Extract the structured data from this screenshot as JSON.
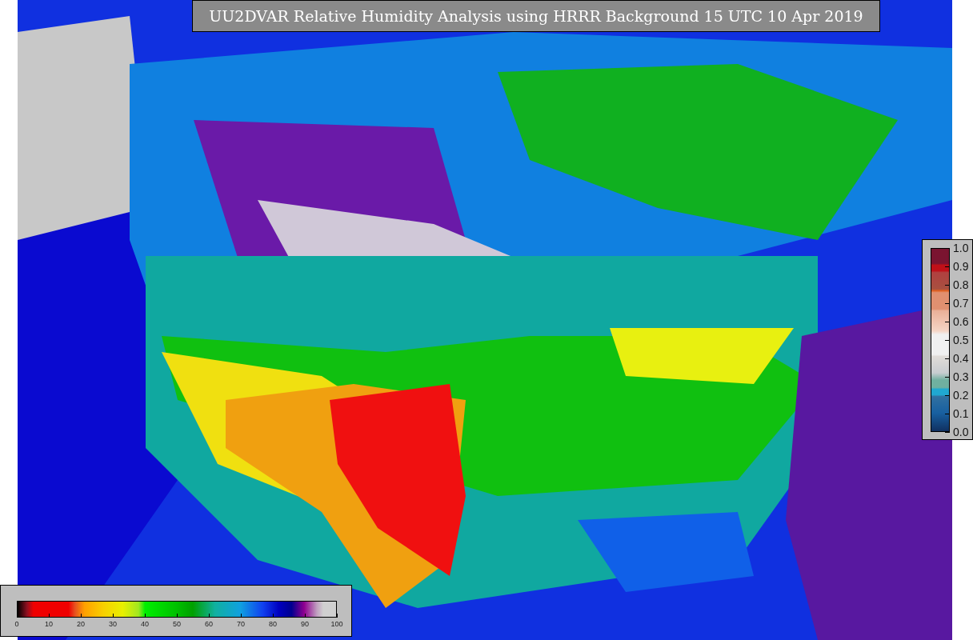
{
  "title": "UU2DVAR Relative Humidity Analysis using HRRR Background 15 UTC 10 Apr 2019",
  "ratio_colorbar": {
    "ticks": [
      "1.0",
      "0.9",
      "0.8",
      "0.7",
      "0.6",
      "0.5",
      "0.4",
      "0.3",
      "0.2",
      "0.1",
      "0.0"
    ]
  },
  "humidity_colorbar": {
    "ticks": [
      "0",
      "10",
      "20",
      "30",
      "40",
      "50",
      "60",
      "70",
      "80",
      "90",
      "100"
    ]
  }
}
